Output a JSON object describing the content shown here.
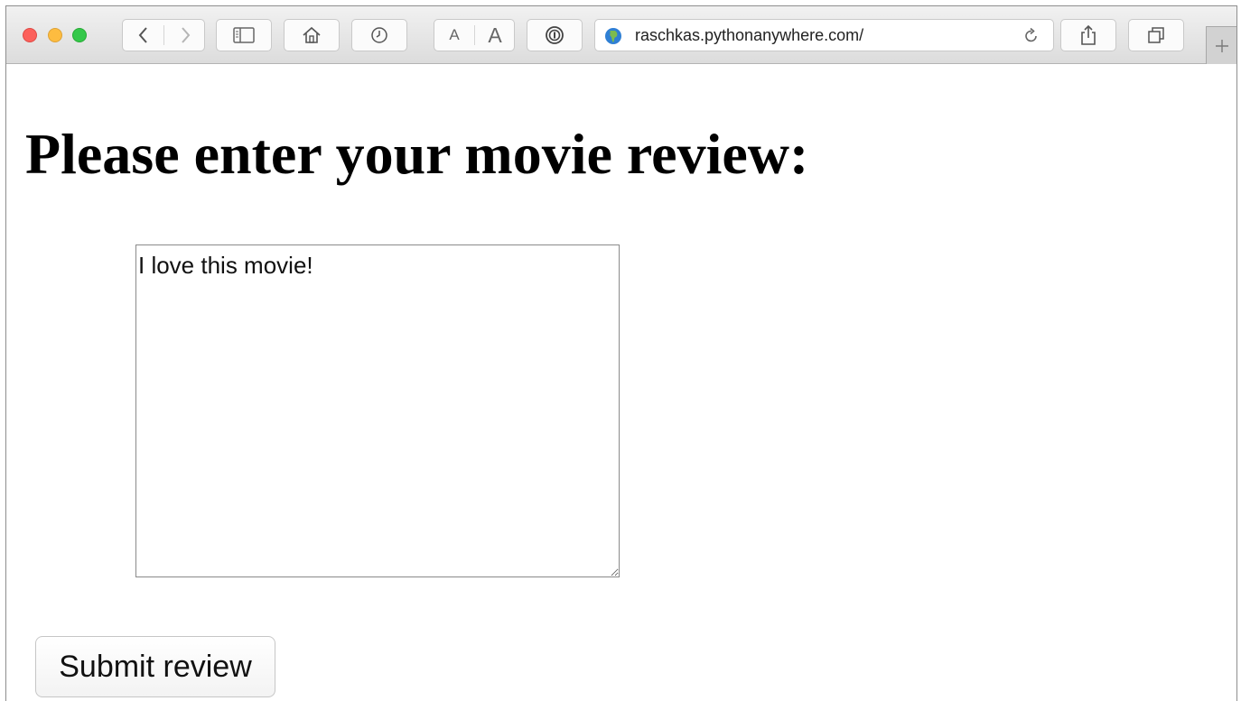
{
  "browser": {
    "url": "raschkas.pythonanywhere.com/",
    "text_size_small": "A",
    "text_size_large": "A",
    "icons": {
      "back": "chevron-left-icon",
      "forward": "chevron-right-icon",
      "sidebar": "sidebar-icon",
      "home": "home-icon",
      "history": "clock-icon",
      "password": "password-icon",
      "site": "globe-icon",
      "reload": "reload-icon",
      "share": "share-icon",
      "tabs": "tabs-icon",
      "new_tab": "plus-icon"
    },
    "colors": {
      "close": "#fc605b",
      "minimize": "#fdbc40",
      "zoom": "#34c84a",
      "globe": "#2f7fd4"
    }
  },
  "page": {
    "heading": "Please enter your movie review:",
    "review_text": "I love this movie!",
    "submit_label": "Submit review"
  }
}
